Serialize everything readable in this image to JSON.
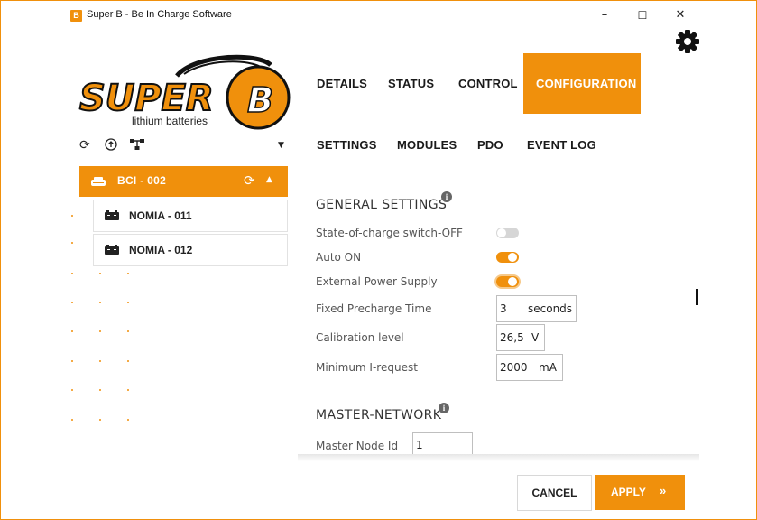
{
  "window": {
    "title": "Super B - Be In Charge Software",
    "app_icon_letter": "B",
    "minimize": "–",
    "maximize": "☐",
    "close": "✕"
  },
  "logo": {
    "brand": "SUPER",
    "letter": "B",
    "tagline": "lithium batteries"
  },
  "toolbar": {
    "refresh_icon": "refresh-icon",
    "upload_icon": "upload-icon",
    "network_icon": "network-icon",
    "dropdown_icon": "chevron-down-icon"
  },
  "tree": {
    "network": {
      "label": "BCI - 002"
    },
    "devices": [
      {
        "label": "NOMIA - 011"
      },
      {
        "label": "NOMIA - 012"
      }
    ]
  },
  "nav": {
    "tabs": [
      {
        "label": "DETAILS"
      },
      {
        "label": "STATUS"
      },
      {
        "label": "CONTROL"
      },
      {
        "label": "CONFIGURATION"
      }
    ],
    "subtabs": [
      {
        "label": "SETTINGS"
      },
      {
        "label": "MODULES"
      },
      {
        "label": "PDO"
      },
      {
        "label": "EVENT LOG"
      }
    ]
  },
  "general": {
    "title": "GENERAL SETTINGS",
    "soc_switch_off": {
      "label": "State-of-charge switch-OFF",
      "enabled": false
    },
    "auto_on": {
      "label": "Auto ON",
      "enabled": true
    },
    "external_power": {
      "label": "External Power Supply",
      "enabled": true
    },
    "precharge": {
      "label": "Fixed Precharge Time",
      "value": "3",
      "unit": "seconds"
    },
    "calibration": {
      "label": "Calibration level",
      "value": "26,5",
      "unit": "V"
    },
    "min_irequest": {
      "label": "Minimum I-request",
      "value": "2000",
      "unit": "mA"
    }
  },
  "master": {
    "title": "MASTER-NETWORK",
    "node_id": {
      "label": "Master Node Id",
      "value": "1"
    }
  },
  "actions": {
    "cancel": "CANCEL",
    "apply": "APPLY",
    "apply_chevron": "»"
  },
  "colors": {
    "accent": "#f0900c"
  }
}
